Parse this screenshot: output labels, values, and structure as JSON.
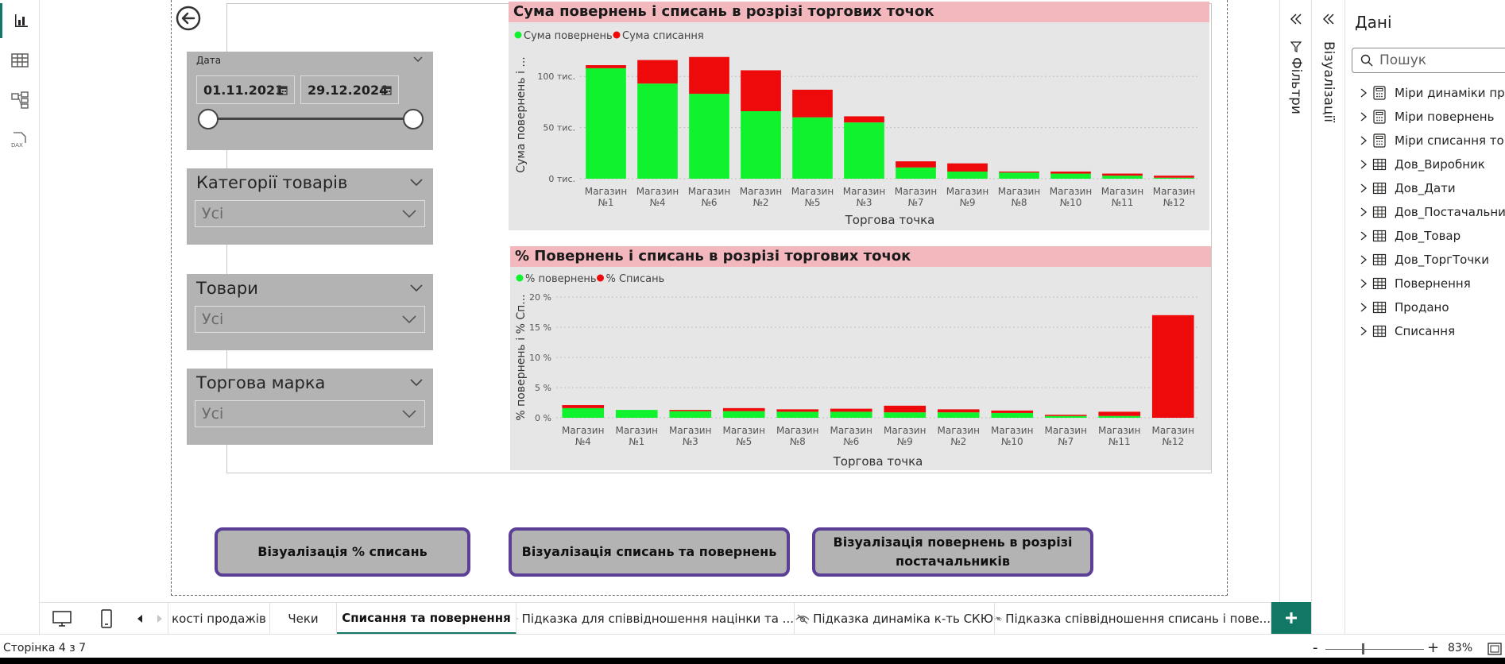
{
  "window": {
    "page_indicator": "Сторінка 4 з 7",
    "zoom": "83%",
    "zoom_minus": "-",
    "zoom_plus": "+"
  },
  "slicers": {
    "date": {
      "title": "Дата",
      "from": "01.11.2021",
      "to": "29.12.2024",
      "range_fraction": [
        0,
        1
      ]
    },
    "category": {
      "title": "Категорії товарів",
      "value": "Усі"
    },
    "products": {
      "title": "Товари",
      "value": "Усі"
    },
    "brand": {
      "title": "Торгова марка",
      "value": "Усі"
    }
  },
  "chart_data": [
    {
      "type": "bar",
      "stacked": true,
      "title": "Сума повернень і списань в розрізі торгових точок",
      "xlabel": "Торгова точка",
      "ylabel": "Сума повернень і ...",
      "yticks": [
        "0 тис.",
        "50 тис.",
        "100 тис."
      ],
      "ylim": [
        0,
        125
      ],
      "grid": true,
      "legend_position": "top-left",
      "categories": [
        [
          "Магазин",
          "№1"
        ],
        [
          "Магазин",
          "№4"
        ],
        [
          "Магазин",
          "№6"
        ],
        [
          "Магазин",
          "№2"
        ],
        [
          "Магазин",
          "№5"
        ],
        [
          "Магазин",
          "№3"
        ],
        [
          "Магазин",
          "№7"
        ],
        [
          "Магазин",
          "№9"
        ],
        [
          "Магазин",
          "№8"
        ],
        [
          "Магазин",
          "№10"
        ],
        [
          "Магазин",
          "№11"
        ],
        [
          "Магазин",
          "№12"
        ]
      ],
      "series": [
        {
          "name": "Сума повернень",
          "color": "#11f22e",
          "values": [
            108,
            93,
            83,
            66,
            60,
            55,
            11,
            7,
            6,
            5,
            3,
            1
          ]
        },
        {
          "name": "Сума списання",
          "color": "#ee0a0a",
          "values": [
            3,
            23,
            36,
            40,
            27,
            6,
            6,
            8,
            1,
            2,
            2,
            2
          ]
        }
      ]
    },
    {
      "type": "bar",
      "stacked": true,
      "title": "% Повернень і списань в розрізі торгових точок",
      "xlabel": "Торгова точка",
      "ylabel": "% повернень і % Сп...",
      "yticks": [
        "0 %",
        "5 %",
        "10 %",
        "15 %",
        "20 %"
      ],
      "ylim": [
        0,
        20
      ],
      "grid": true,
      "legend_position": "top-left",
      "categories": [
        [
          "Магазин",
          "№4"
        ],
        [
          "Магазин",
          "№1"
        ],
        [
          "Магазин",
          "№3"
        ],
        [
          "Магазин",
          "№5"
        ],
        [
          "Магазин",
          "№8"
        ],
        [
          "Магазин",
          "№6"
        ],
        [
          "Магазин",
          "№9"
        ],
        [
          "Магазин",
          "№2"
        ],
        [
          "Магазин",
          "№10"
        ],
        [
          "Магазин",
          "№7"
        ],
        [
          "Магазин",
          "№11"
        ],
        [
          "Магазин",
          "№12"
        ]
      ],
      "series": [
        {
          "name": "% повернень",
          "color": "#11f22e",
          "values": [
            1.6,
            1.3,
            1.1,
            1.1,
            1.0,
            1.0,
            0.9,
            0.9,
            0.8,
            0.3,
            0.3,
            0
          ]
        },
        {
          "name": "% Списань",
          "color": "#ee0a0a",
          "values": [
            0.5,
            0,
            0.2,
            0.5,
            0.4,
            0.5,
            1.1,
            0.5,
            0.4,
            0.2,
            0.7,
            17
          ]
        }
      ]
    }
  ],
  "buttons": {
    "pct_writeoffs": "Візуалізація % списань",
    "writeoffs_returns": "Візуалізація списань та повернень",
    "returns_by_supplier": "Візуалізація повернень в розрізі постачальників"
  },
  "tabs": [
    {
      "label": "кості продажів",
      "hidden": false,
      "active": false
    },
    {
      "label": "Чеки",
      "hidden": false,
      "active": false
    },
    {
      "label": "Списання та повернення",
      "hidden": false,
      "active": true
    },
    {
      "label": "Підказка для співвідношення націнки та ...",
      "hidden": true,
      "active": false
    },
    {
      "label": "Підказка динаміка к-ть СКЮ",
      "hidden": true,
      "active": false
    },
    {
      "label": "Підказка співвідношення списань і пове...",
      "hidden": true,
      "active": false
    }
  ],
  "panes": {
    "filters_label": "Фільтри",
    "visualizations_label": "Візуалізації",
    "data_title": "Дані",
    "search_placeholder": "Пошук",
    "fields": [
      {
        "label": "Міри динаміки прод",
        "icon": "calculator-icon"
      },
      {
        "label": "Міри повернень",
        "icon": "calculator-icon"
      },
      {
        "label": "Міри списання това",
        "icon": "calculator-icon"
      },
      {
        "label": "Дов_Виробник",
        "icon": "table-icon"
      },
      {
        "label": "Дов_Дати",
        "icon": "table-icon"
      },
      {
        "label": "Дов_Постачальники",
        "icon": "table-icon"
      },
      {
        "label": "Дов_Товар",
        "icon": "table-icon"
      },
      {
        "label": "Дов_ТоргТочки",
        "icon": "table-icon"
      },
      {
        "label": "Повернення",
        "icon": "table-icon"
      },
      {
        "label": "Продано",
        "icon": "table-icon"
      },
      {
        "label": "Списання",
        "icon": "table-icon"
      }
    ]
  }
}
